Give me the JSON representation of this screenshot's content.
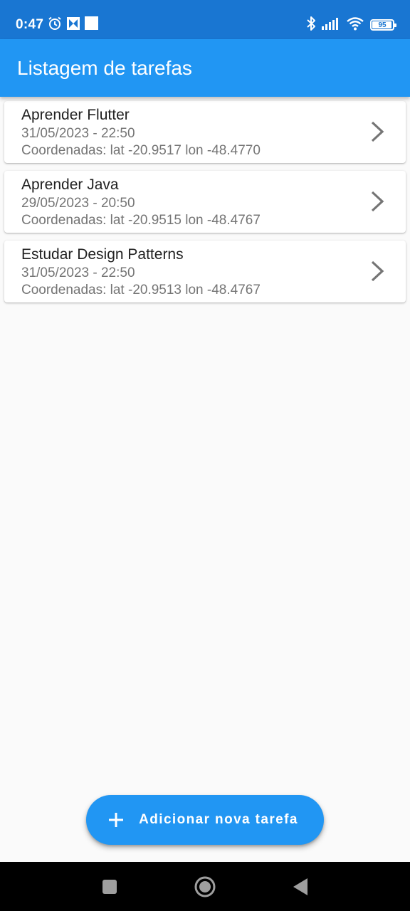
{
  "status_bar": {
    "time": "0:47",
    "battery_level": "95",
    "battery_fraction": 0.95
  },
  "app_bar": {
    "title": "Listagem de tarefas"
  },
  "tasks": [
    {
      "title": "Aprender Flutter",
      "date": "31/05/2023 - 22:50",
      "coords": "Coordenadas: lat -20.9517 lon -48.4770"
    },
    {
      "title": "Aprender Java",
      "date": "29/05/2023 - 20:50",
      "coords": "Coordenadas: lat -20.9515 lon -48.4767"
    },
    {
      "title": "Estudar Design Patterns",
      "date": "31/05/2023 - 22:50",
      "coords": "Coordenadas: lat -20.9513 lon -48.4767"
    }
  ],
  "fab": {
    "label": "Adicionar nova tarefa",
    "icon": "plus-icon"
  },
  "colors": {
    "primary": "#2196f3",
    "status_bar": "#1976d2",
    "background": "#fafafa",
    "secondary_text": "#757575"
  },
  "icons": {
    "status": [
      "alarm-icon",
      "app-notification-icon",
      "square-notification-icon",
      "bluetooth-icon",
      "signal-icon",
      "wifi-icon",
      "battery-icon"
    ],
    "list_item": "chevron-right-icon",
    "nav": [
      "recents-icon",
      "home-icon",
      "back-icon"
    ]
  }
}
